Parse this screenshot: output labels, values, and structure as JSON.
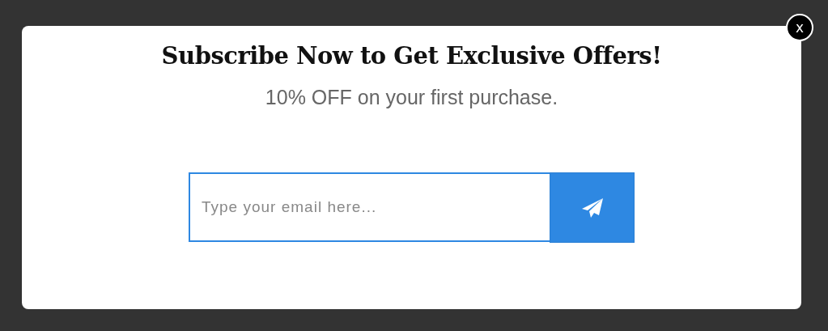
{
  "modal": {
    "close_label": "x",
    "title": "Subscribe Now to Get Exclusive Offers!",
    "subtitle": "10% OFF on your first purchase.",
    "email": {
      "placeholder": "Type your email here..."
    }
  }
}
